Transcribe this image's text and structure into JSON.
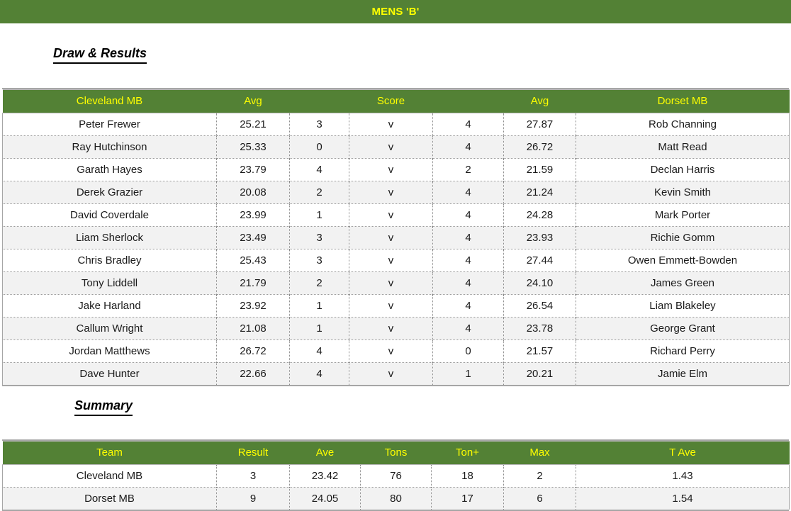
{
  "banner": {
    "title": "MENS 'B'"
  },
  "sections": {
    "draw": {
      "heading": "Draw & Results"
    },
    "summary": {
      "heading": "Summary"
    }
  },
  "colors": {
    "header_green": "#538135",
    "header_text_yellow": "#ffff00",
    "band_even": "#f2f2f2",
    "band_odd": "#ffffff",
    "border_gray": "#a6a6a6"
  },
  "draw_table": {
    "columns": [
      "Cleveland MB",
      "Avg",
      "",
      "Score",
      "",
      "Avg",
      "Dorset MB"
    ],
    "rows": [
      {
        "home_player": "Peter Frewer",
        "home_avg": "25.21",
        "home_score": "3",
        "v": "v",
        "away_score": "4",
        "away_avg": "27.87",
        "away_player": "Rob Channing"
      },
      {
        "home_player": "Ray Hutchinson",
        "home_avg": "25.33",
        "home_score": "0",
        "v": "v",
        "away_score": "4",
        "away_avg": "26.72",
        "away_player": "Matt Read"
      },
      {
        "home_player": "Garath Hayes",
        "home_avg": "23.79",
        "home_score": "4",
        "v": "v",
        "away_score": "2",
        "away_avg": "21.59",
        "away_player": "Declan Harris"
      },
      {
        "home_player": "Derek Grazier",
        "home_avg": "20.08",
        "home_score": "2",
        "v": "v",
        "away_score": "4",
        "away_avg": "21.24",
        "away_player": "Kevin Smith"
      },
      {
        "home_player": "David Coverdale",
        "home_avg": "23.99",
        "home_score": "1",
        "v": "v",
        "away_score": "4",
        "away_avg": "24.28",
        "away_player": "Mark Porter"
      },
      {
        "home_player": "Liam Sherlock",
        "home_avg": "23.49",
        "home_score": "3",
        "v": "v",
        "away_score": "4",
        "away_avg": "23.93",
        "away_player": "Richie Gomm"
      },
      {
        "home_player": "Chris Bradley",
        "home_avg": "25.43",
        "home_score": "3",
        "v": "v",
        "away_score": "4",
        "away_avg": "27.44",
        "away_player": "Owen Emmett-Bowden"
      },
      {
        "home_player": "Tony Liddell",
        "home_avg": "21.79",
        "home_score": "2",
        "v": "v",
        "away_score": "4",
        "away_avg": "24.10",
        "away_player": "James Green"
      },
      {
        "home_player": "Jake Harland",
        "home_avg": "23.92",
        "home_score": "1",
        "v": "v",
        "away_score": "4",
        "away_avg": "26.54",
        "away_player": "Liam Blakeley"
      },
      {
        "home_player": "Callum Wright",
        "home_avg": "21.08",
        "home_score": "1",
        "v": "v",
        "away_score": "4",
        "away_avg": "23.78",
        "away_player": "George Grant"
      },
      {
        "home_player": "Jordan Matthews",
        "home_avg": "26.72",
        "home_score": "4",
        "v": "v",
        "away_score": "0",
        "away_avg": "21.57",
        "away_player": "Richard Perry"
      },
      {
        "home_player": "Dave Hunter",
        "home_avg": "22.66",
        "home_score": "4",
        "v": "v",
        "away_score": "1",
        "away_avg": "20.21",
        "away_player": "Jamie Elm"
      }
    ]
  },
  "summary_table": {
    "columns": [
      "Team",
      "Result",
      "Ave",
      "Tons",
      "Ton+",
      "Max",
      "T Ave"
    ],
    "rows": [
      {
        "team": "Cleveland MB",
        "result": "3",
        "ave": "23.42",
        "tons": "76",
        "ton_plus": "18",
        "max": "2",
        "t_ave": "1.43"
      },
      {
        "team": "Dorset MB",
        "result": "9",
        "ave": "24.05",
        "tons": "80",
        "ton_plus": "17",
        "max": "6",
        "t_ave": "1.54"
      }
    ]
  }
}
